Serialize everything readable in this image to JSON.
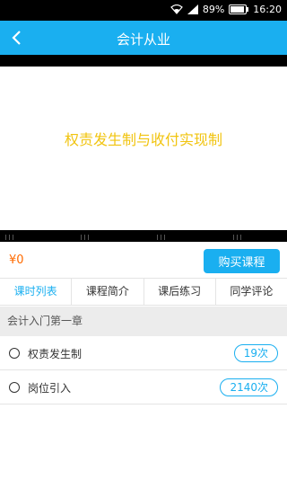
{
  "status_bar": {
    "battery": "89%",
    "time": "16:20"
  },
  "app_bar": {
    "title": "会计从业"
  },
  "video": {
    "lesson_title": "权责发生制与收付实现制"
  },
  "purchase": {
    "price": "¥0",
    "buy_label": "购买课程"
  },
  "tabs": [
    {
      "label": "课时列表"
    },
    {
      "label": "课程简介"
    },
    {
      "label": "课后练习"
    },
    {
      "label": "同学评论"
    }
  ],
  "chapter": {
    "title": "会计入门第一章"
  },
  "lessons": [
    {
      "title": "权责发生制",
      "count": "19次"
    },
    {
      "title": "岗位引入",
      "count": "2140次"
    }
  ],
  "colors": {
    "accent": "#1aaff0",
    "price": "#ff6a00",
    "lesson_title": "#f1c40f"
  }
}
